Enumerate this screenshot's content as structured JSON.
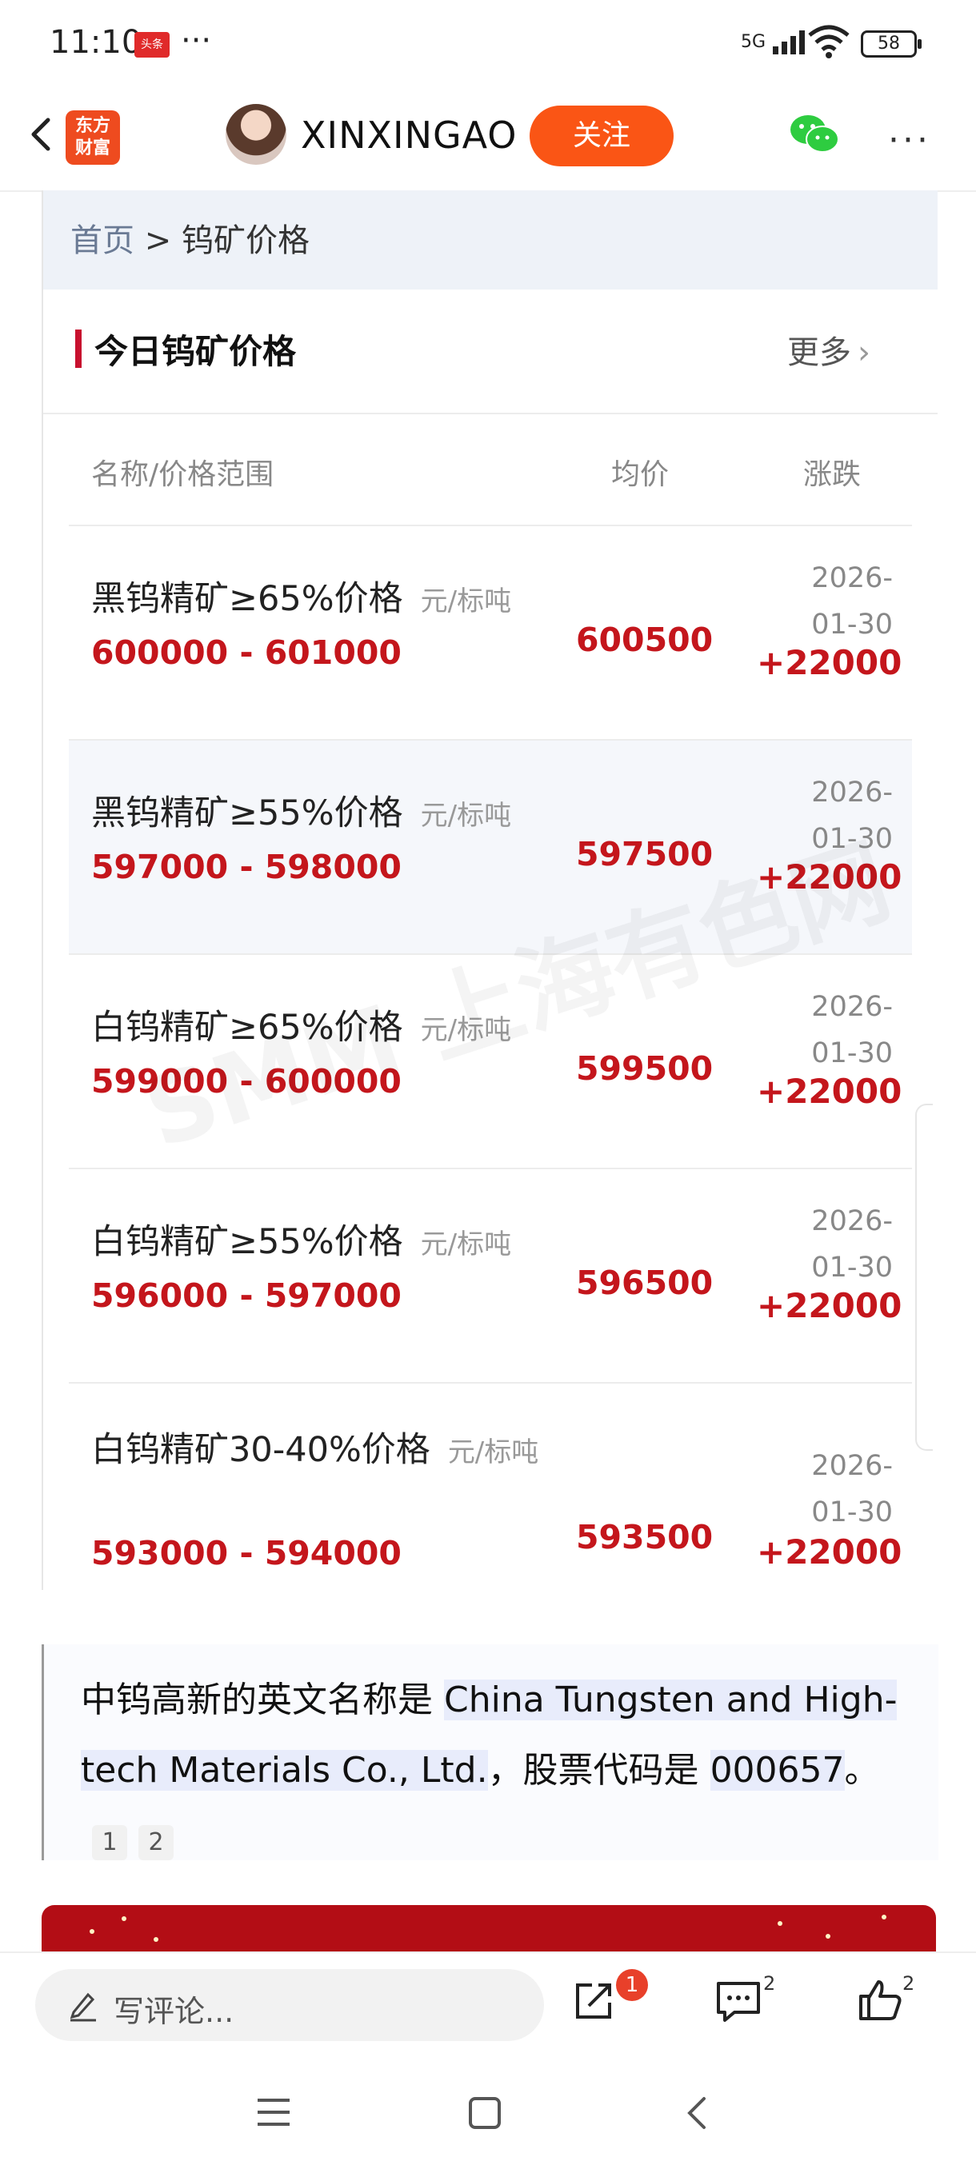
{
  "status_bar": {
    "time": "11:10",
    "app_badge": "头条",
    "dots": "···",
    "signal": "5G",
    "battery": "58"
  },
  "header": {
    "logo_line1": "东方",
    "logo_line2": "财富",
    "author": "XINXINGAO",
    "follow_label": "关注",
    "more": "···"
  },
  "breadcrumb": {
    "home": "首页",
    "separator": " > ",
    "current": "钨矿价格"
  },
  "section": {
    "title": "今日钨矿价格",
    "more_label": "更多"
  },
  "table": {
    "headers": [
      "名称/价格范围",
      "均价",
      "涨跌"
    ],
    "rows": [
      {
        "name": "黑钨精矿≥65%价格",
        "unit": "元/标吨",
        "range": "600000 - 601000",
        "avg": "600500",
        "date": "2026-01-30",
        "change": "+22000"
      },
      {
        "name": "黑钨精矿≥55%价格",
        "unit": "元/标吨",
        "range": "597000 - 598000",
        "avg": "597500",
        "date": "2026-01-30",
        "change": "+22000"
      },
      {
        "name": "白钨精矿≥65%价格",
        "unit": "元/标吨",
        "range": "599000 - 600000",
        "avg": "599500",
        "date": "2026-01-30",
        "change": "+22000"
      },
      {
        "name": "白钨精矿≥55%价格",
        "unit": "元/标吨",
        "range": "596000 - 597000",
        "avg": "596500",
        "date": "2026-01-30",
        "change": "+22000"
      },
      {
        "name": "白钨精矿30-40%价格",
        "unit": "元/标吨",
        "range": "593000 - 594000",
        "avg": "593500",
        "date": "2026-01-30",
        "change": "+22000"
      }
    ]
  },
  "watermark": "SMM 上海有色网",
  "quote": {
    "prefix": "中钨高新的英文名称是 ",
    "english_name": "China Tungsten and High-tech Materials Co., Ltd.",
    "middle": "，股票代码是 ",
    "code": "000657",
    "suffix": "。",
    "refs": [
      "1",
      "2"
    ]
  },
  "comment_bar": {
    "placeholder": "写评论...",
    "share_badge": "1",
    "comment_count": "2",
    "like_count": "2"
  },
  "colors": {
    "accent": "#fa5515",
    "price_red": "#c4161c",
    "title_bar": "#c8102e"
  }
}
